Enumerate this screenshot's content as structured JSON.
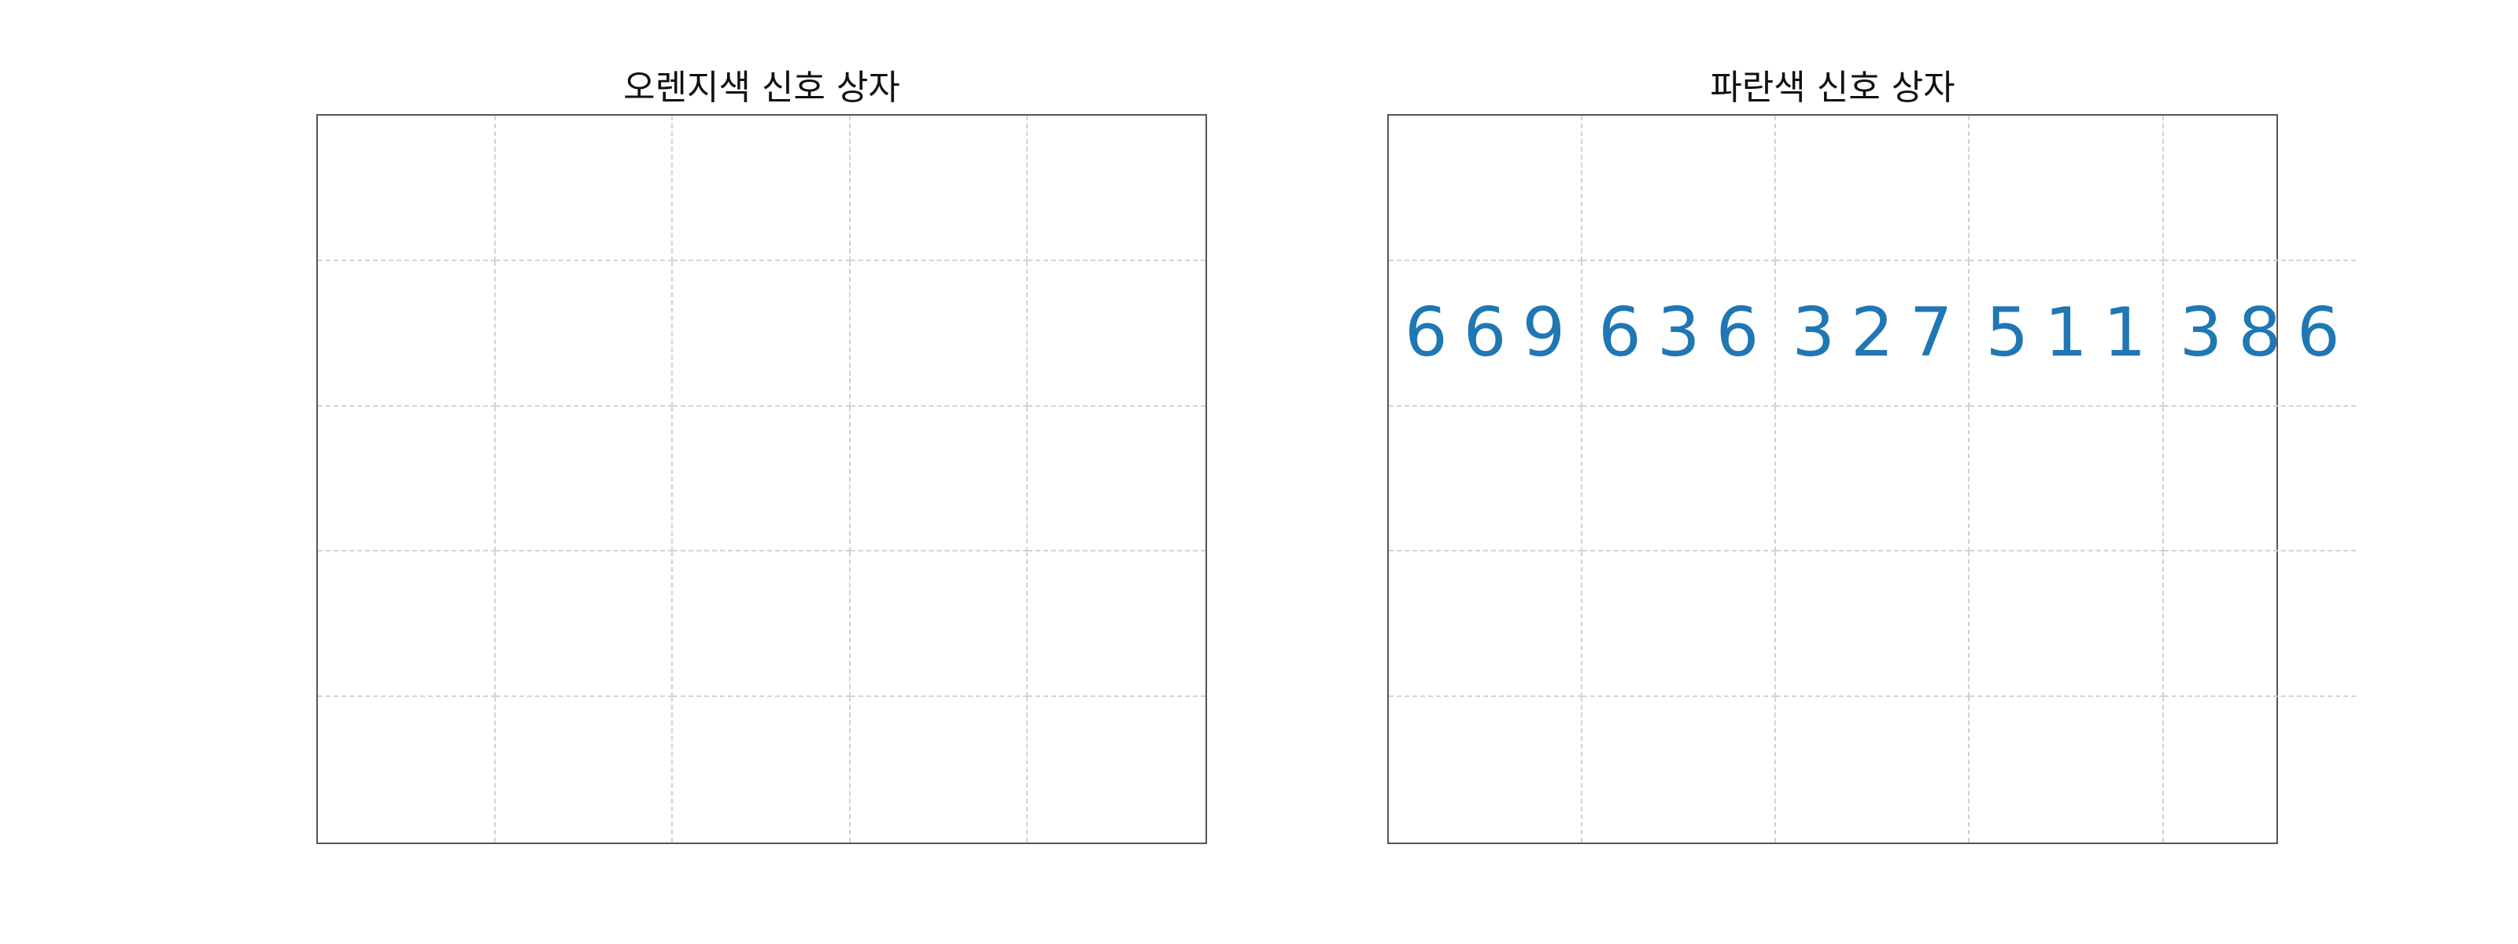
{
  "panels": [
    {
      "title": "오렌지색 신호 상자",
      "color": "#ff7f0e",
      "rows": [
        [
          "",
          "",
          "",
          "",
          ""
        ],
        [
          "",
          "",
          "",
          "",
          ""
        ],
        [
          "",
          "",
          "",
          "",
          ""
        ],
        [
          "",
          "",
          "",
          "",
          ""
        ],
        [
          "",
          "",
          "",
          "",
          ""
        ]
      ]
    },
    {
      "title": "파란색 신호 상자",
      "color": "#1f77b4",
      "rows": [
        [
          "",
          "",
          "",
          "",
          ""
        ],
        [
          "669",
          "636",
          "327",
          "511",
          "386"
        ],
        [
          "",
          "",
          "",
          "",
          ""
        ],
        [
          "",
          "",
          "",
          "",
          ""
        ],
        [
          "",
          "",
          "",
          "",
          ""
        ]
      ]
    }
  ]
}
